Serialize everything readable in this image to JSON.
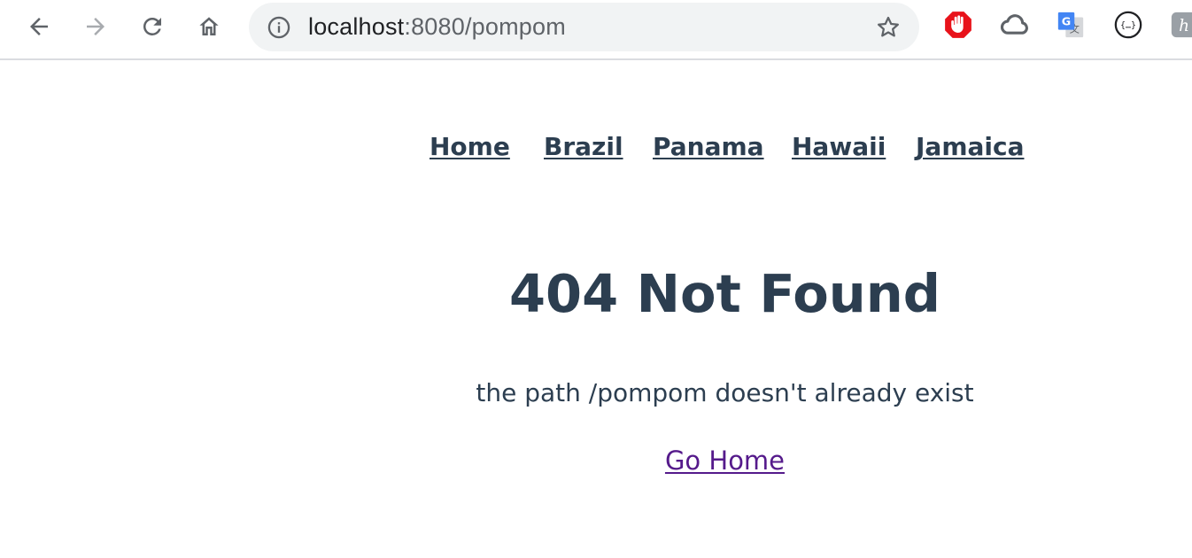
{
  "browser": {
    "url_host": "localhost",
    "url_rest": ":8080/pompom",
    "accent_icon_color": "#5f6368",
    "disabled_icon_color": "#a8abaf",
    "omnibox_bg": "#f1f3f4",
    "extensions": [
      {
        "name": "adblock-icon",
        "color": "#e8121a"
      },
      {
        "name": "cloud-icon",
        "color": "#5f6368"
      },
      {
        "name": "google-translate-icon",
        "color": "#4285f4"
      },
      {
        "name": "json-viewer-icon",
        "color": "#202124"
      },
      {
        "name": "extension-partial-icon",
        "color": "#9aa0a6"
      }
    ]
  },
  "nav": {
    "items": [
      {
        "label": "Home"
      },
      {
        "label": "Brazil"
      },
      {
        "label": "Panama"
      },
      {
        "label": "Hawaii"
      },
      {
        "label": "Jamaica"
      }
    ],
    "color": "#2c3e50"
  },
  "main": {
    "title": "404 Not Found",
    "message": "the path /pompom doesn't already exist",
    "go_home_label": "Go Home",
    "link_color": "#551a8b"
  }
}
